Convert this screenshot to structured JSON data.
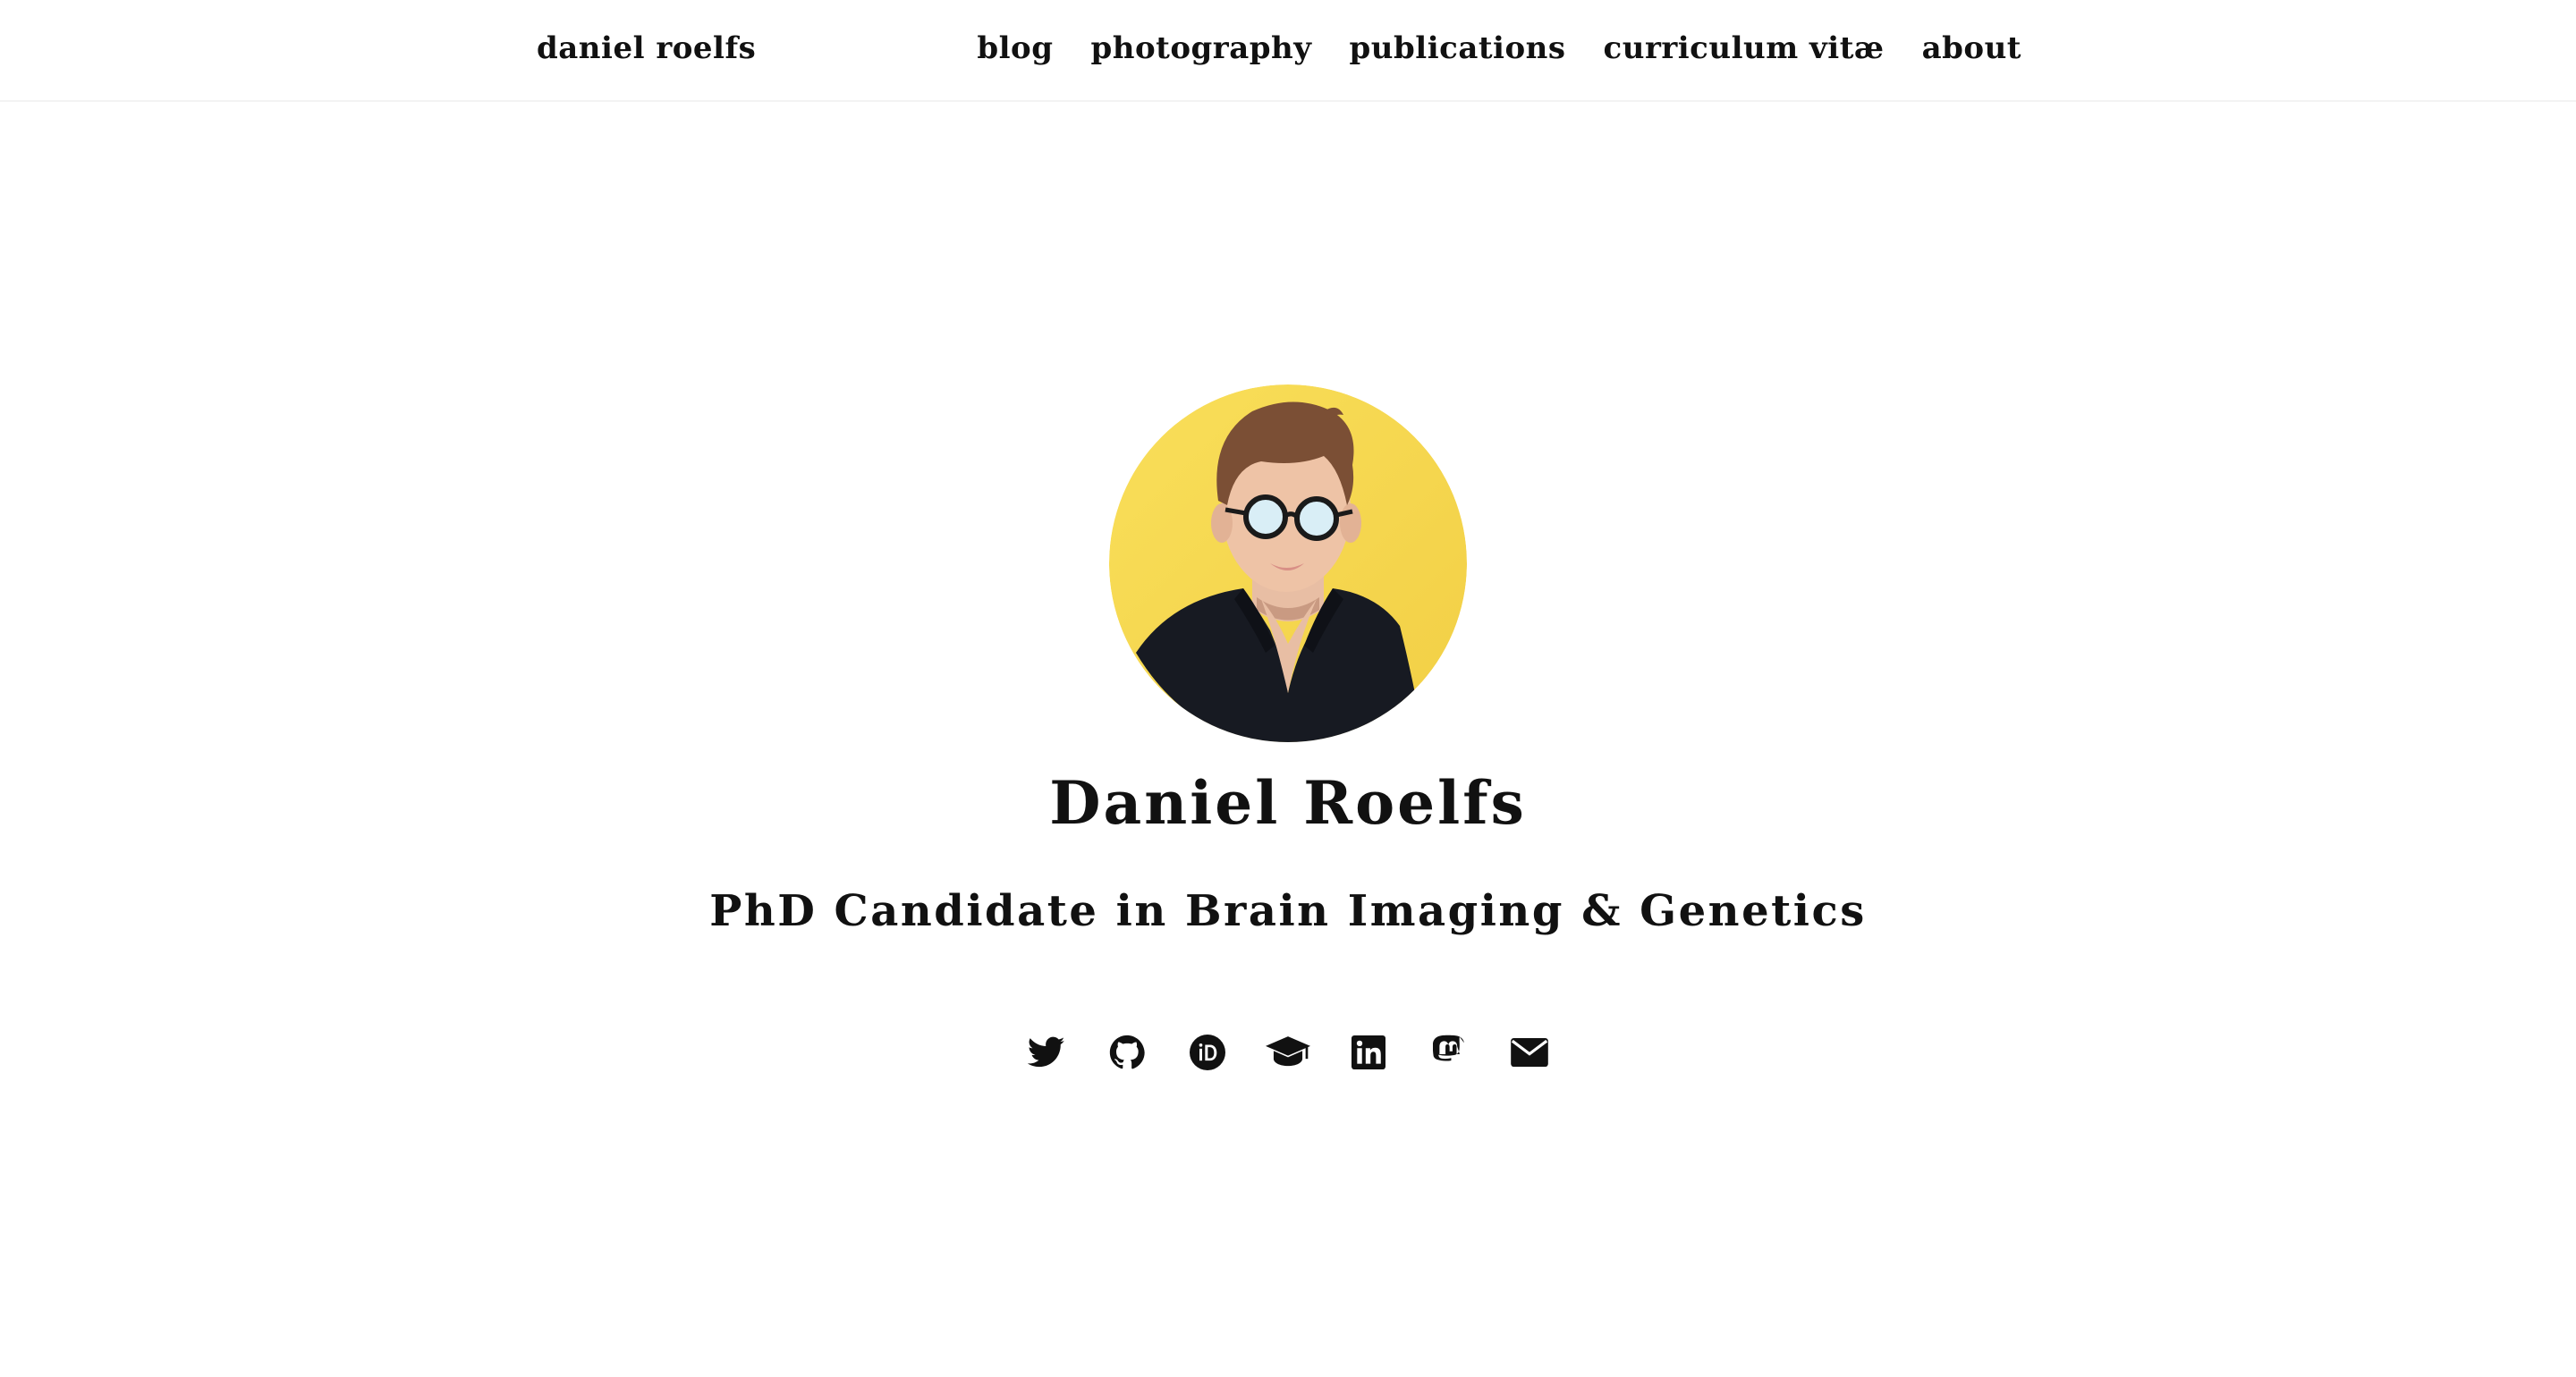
{
  "navbar": {
    "brand": "daniel roelfs",
    "links": [
      {
        "label": "blog"
      },
      {
        "label": "photography"
      },
      {
        "label": "publications"
      },
      {
        "label": "curriculum vitæ"
      },
      {
        "label": "about"
      }
    ]
  },
  "hero": {
    "name": "Daniel Roelfs",
    "subtitle": "PhD Candidate in Brain Imaging & Genetics",
    "avatar_background": "#f5d547",
    "social_icons": [
      "twitter-icon",
      "github-icon",
      "orcid-icon",
      "graduation-cap-icon",
      "linkedin-icon",
      "mastodon-icon",
      "envelope-icon"
    ]
  }
}
